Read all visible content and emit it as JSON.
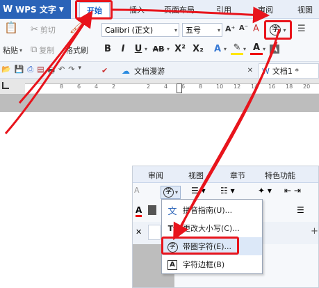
{
  "app": {
    "name": "WPS 文字",
    "tabs": [
      "开始",
      "插入",
      "页面布局",
      "引用",
      "审阅",
      "视图"
    ]
  },
  "ribbon": {
    "cut_label": "剪切",
    "copy_label": "复制",
    "paste_label": "粘贴",
    "format_painter_label": "格式刷",
    "font_name": "Calibri (正文)",
    "font_size": "五号",
    "enclose_char_glyph": "字",
    "bold": "B",
    "italic": "I",
    "underline": "U",
    "strikethrough": "AB",
    "superscript": "X²",
    "subscript": "X₂",
    "grow_font": "A⁺",
    "shrink_font": "A⁻"
  },
  "quickbar": {
    "doc_tab_1": "文档漫游",
    "doc_tab_2": "文档1 *",
    "close_glyph": "✕"
  },
  "ruler": {
    "ticks": [
      "8",
      "6",
      "4",
      "2",
      "",
      "2",
      "4",
      "6",
      "8",
      "10",
      "12",
      "14",
      "16",
      "18",
      "20"
    ]
  },
  "shot2": {
    "tabs": [
      "审阅",
      "视图",
      "章节",
      "特色功能"
    ],
    "enclose_char_glyph": "字"
  },
  "menu": {
    "items": [
      {
        "icon": "文",
        "label": "拼音指南(U)..."
      },
      {
        "icon": "Tt",
        "label": "更改大小写(C)..."
      },
      {
        "icon": "字",
        "label": "带圈字符(E)..."
      },
      {
        "icon": "A",
        "label": "字符边框(B)"
      }
    ]
  },
  "colors": {
    "highlight": "#e8141c",
    "app_blue": "#2a63b8",
    "accent_text": "#1a66cc"
  }
}
